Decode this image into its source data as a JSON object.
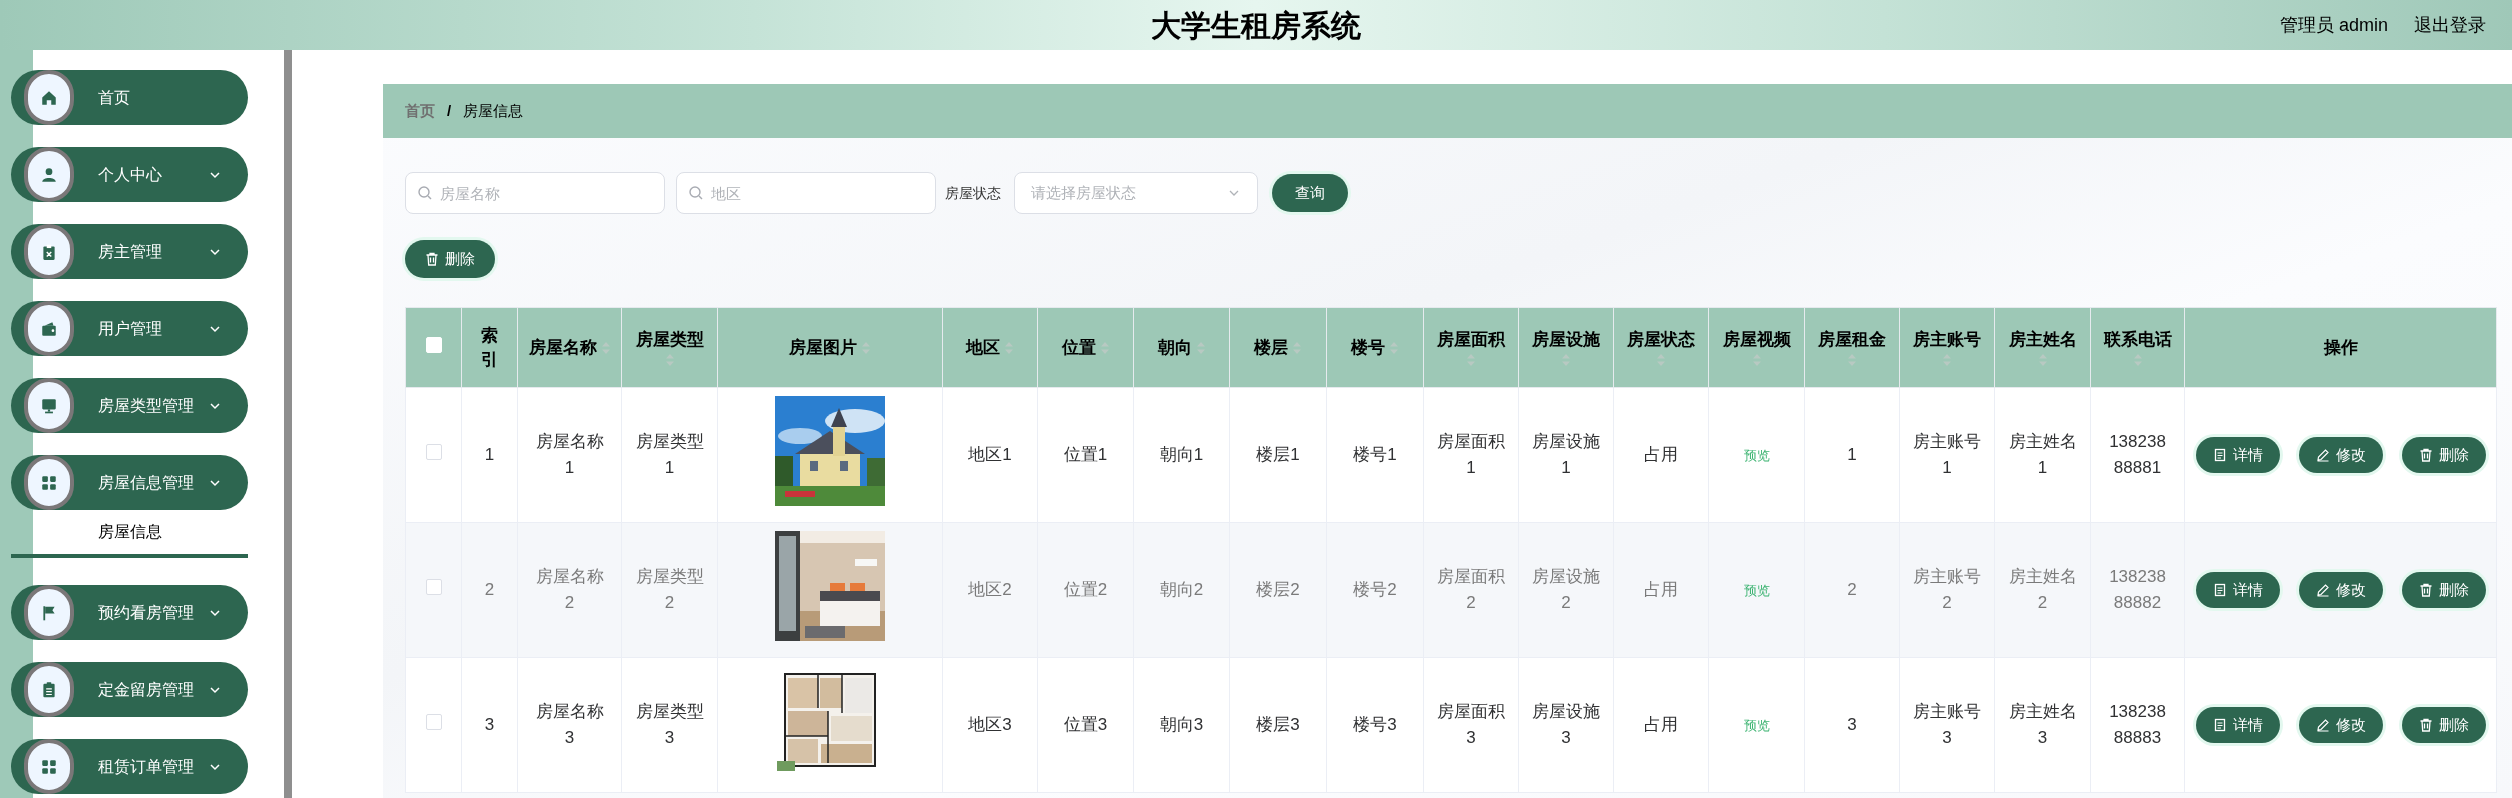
{
  "header": {
    "title": "大学生租房系统",
    "user": "管理员 admin",
    "logout": "退出登录"
  },
  "sidebar": {
    "items": [
      {
        "label": "首页",
        "kind": "link"
      },
      {
        "label": "个人中心",
        "kind": "menu"
      },
      {
        "label": "房主管理",
        "kind": "menu"
      },
      {
        "label": "用户管理",
        "kind": "menu"
      },
      {
        "label": "房屋类型管理",
        "kind": "menu"
      },
      {
        "label": "房屋信息管理",
        "kind": "menu",
        "children": [
          {
            "label": "房屋信息",
            "selected": true
          }
        ]
      },
      {
        "label": "预约看房管理",
        "kind": "menu"
      },
      {
        "label": "定金留房管理",
        "kind": "menu"
      },
      {
        "label": "租赁订单管理",
        "kind": "menu"
      }
    ]
  },
  "breadcrumb": {
    "separator": "/",
    "items": [
      "首页",
      "房屋信息"
    ]
  },
  "search": {
    "fields": [
      {
        "placeholder": "房屋名称"
      },
      {
        "placeholder": "地区"
      }
    ],
    "status_label": "房屋状态",
    "status_placeholder": "请选择房屋状态",
    "button": "查询"
  },
  "toolbar": {
    "delete_button": "删除"
  },
  "table": {
    "header_checkbox": {
      "checked": false
    },
    "columns": [
      {
        "label": "索引",
        "sortable": false
      },
      {
        "label": "房屋名称",
        "sortable": true
      },
      {
        "label": "房屋类型",
        "sortable": true
      },
      {
        "label": "房屋图片",
        "sortable": true
      },
      {
        "label": "地区",
        "sortable": true
      },
      {
        "label": "位置",
        "sortable": true
      },
      {
        "label": "朝向",
        "sortable": true
      },
      {
        "label": "楼层",
        "sortable": true
      },
      {
        "label": "楼号",
        "sortable": true
      },
      {
        "label": "房屋面积",
        "sortable": true
      },
      {
        "label": "房屋设施",
        "sortable": true
      },
      {
        "label": "房屋状态",
        "sortable": true
      },
      {
        "label": "房屋视频",
        "sortable": true
      },
      {
        "label": "房屋租金",
        "sortable": true
      },
      {
        "label": "房主账号",
        "sortable": true
      },
      {
        "label": "房主姓名",
        "sortable": true
      },
      {
        "label": "联系电话",
        "sortable": true
      },
      {
        "label": "操作",
        "sortable": false
      }
    ],
    "rows": [
      {
        "checked": false,
        "highlighted": false,
        "cells": [
          {
            "kind": "text",
            "text": "1"
          },
          {
            "kind": "text",
            "text": "房屋名称1"
          },
          {
            "kind": "text",
            "text": "房屋类型1"
          },
          {
            "kind": "picture"
          },
          {
            "kind": "text",
            "text": "地区1"
          },
          {
            "kind": "text",
            "text": "位置1"
          },
          {
            "kind": "text",
            "text": "朝向1"
          },
          {
            "kind": "text",
            "text": "楼层1"
          },
          {
            "kind": "text",
            "text": "楼号1"
          },
          {
            "kind": "text",
            "text": "房屋面积1"
          },
          {
            "kind": "text",
            "text": "房屋设施1"
          },
          {
            "kind": "text",
            "text": "占用"
          },
          {
            "kind": "link",
            "text": "预览"
          },
          {
            "kind": "text",
            "text": "1"
          },
          {
            "kind": "text",
            "text": "房主账号1"
          },
          {
            "kind": "text",
            "text": "房主姓名1"
          },
          {
            "kind": "phone",
            "text": "13823888881"
          },
          {
            "kind": "actions",
            "buttons": [
              "详情",
              "修改",
              "删除"
            ]
          }
        ]
      },
      {
        "checked": false,
        "highlighted": true,
        "cells": [
          {
            "kind": "text",
            "text": "2"
          },
          {
            "kind": "text",
            "text": "房屋名称2"
          },
          {
            "kind": "text",
            "text": "房屋类型2"
          },
          {
            "kind": "picture"
          },
          {
            "kind": "text",
            "text": "地区2"
          },
          {
            "kind": "text",
            "text": "位置2"
          },
          {
            "kind": "text",
            "text": "朝向2"
          },
          {
            "kind": "text",
            "text": "楼层2"
          },
          {
            "kind": "text",
            "text": "楼号2"
          },
          {
            "kind": "text",
            "text": "房屋面积2"
          },
          {
            "kind": "text",
            "text": "房屋设施2"
          },
          {
            "kind": "text",
            "text": "占用"
          },
          {
            "kind": "link",
            "text": "预览"
          },
          {
            "kind": "text",
            "text": "2"
          },
          {
            "kind": "text",
            "text": "房主账号2"
          },
          {
            "kind": "text",
            "text": "房主姓名2"
          },
          {
            "kind": "phone",
            "text": "13823888882"
          },
          {
            "kind": "actions",
            "buttons": [
              "详情",
              "修改",
              "删除"
            ]
          }
        ]
      },
      {
        "checked": false,
        "highlighted": false,
        "cells": [
          {
            "kind": "text",
            "text": "3"
          },
          {
            "kind": "text",
            "text": "房屋名称3"
          },
          {
            "kind": "text",
            "text": "房屋类型3"
          },
          {
            "kind": "picture"
          },
          {
            "kind": "text",
            "text": "地区3"
          },
          {
            "kind": "text",
            "text": "位置3"
          },
          {
            "kind": "text",
            "text": "朝向3"
          },
          {
            "kind": "text",
            "text": "楼层3"
          },
          {
            "kind": "text",
            "text": "楼号3"
          },
          {
            "kind": "text",
            "text": "房屋面积3"
          },
          {
            "kind": "text",
            "text": "房屋设施3"
          },
          {
            "kind": "text",
            "text": "占用"
          },
          {
            "kind": "link",
            "text": "预览"
          },
          {
            "kind": "text",
            "text": "3"
          },
          {
            "kind": "text",
            "text": "房主账号3"
          },
          {
            "kind": "text",
            "text": "房主姓名3"
          },
          {
            "kind": "phone",
            "text": "13823888883"
          },
          {
            "kind": "actions",
            "buttons": [
              "详情",
              "修改",
              "删除"
            ]
          }
        ]
      }
    ]
  }
}
